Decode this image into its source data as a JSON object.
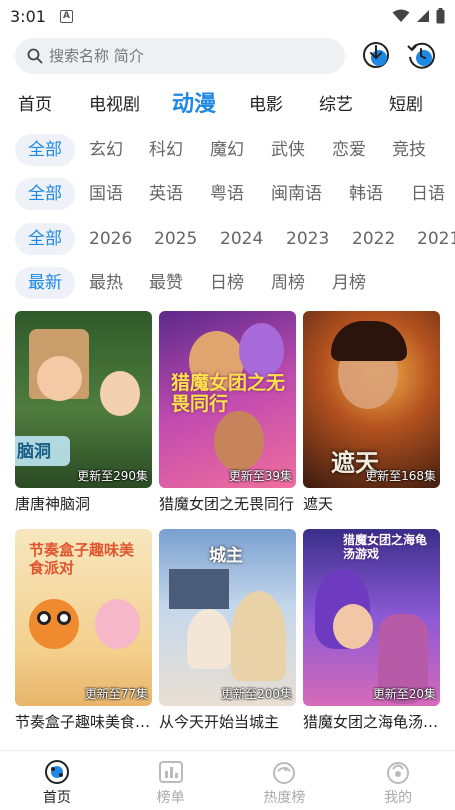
{
  "status": {
    "time": "3:01",
    "notif_icon": "a-badge-icon"
  },
  "search": {
    "placeholder": "搜索名称 简介"
  },
  "top_icons": [
    "download-icon",
    "history-icon"
  ],
  "main_tabs": [
    {
      "label": "首页",
      "active": false
    },
    {
      "label": "电视剧",
      "active": false
    },
    {
      "label": "动漫",
      "active": true
    },
    {
      "label": "电影",
      "active": false
    },
    {
      "label": "综艺",
      "active": false
    },
    {
      "label": "短剧",
      "active": false
    }
  ],
  "filters": {
    "genre": [
      "全部",
      "玄幻",
      "科幻",
      "魔幻",
      "武侠",
      "恋爱",
      "竞技"
    ],
    "language": [
      "全部",
      "国语",
      "英语",
      "粤语",
      "闽南语",
      "韩语",
      "日语"
    ],
    "year": [
      "全部",
      "2026",
      "2025",
      "2024",
      "2023",
      "2022",
      "2021"
    ],
    "sort": [
      "最新",
      "最热",
      "最赞",
      "日榜",
      "周榜",
      "月榜"
    ]
  },
  "cards": [
    {
      "title": "唐唐神脑洞",
      "badge": "更新至290集",
      "thumb_text": "脑洞",
      "bg": "#3f6b35"
    },
    {
      "title": "猎魔女团之无畏同行",
      "badge": "更新至39集",
      "thumb_text": "猎魔女团之无畏同行",
      "bg": "#b048a8"
    },
    {
      "title": "遮天",
      "badge": "更新至168集",
      "thumb_text": "遮天",
      "bg": "#8a3a1e"
    },
    {
      "title": "节奏盒子趣味美食派对",
      "badge": "更新至77集",
      "thumb_text": "节奏盒子趣味美食派对",
      "bg": "#f1d6a0"
    },
    {
      "title": "从今天开始当城主",
      "badge": "更新至200集",
      "thumb_text": "城主",
      "bg": "#6d8fb8"
    },
    {
      "title": "猎魔女团之海龟汤游戏",
      "badge": "更新至20集",
      "thumb_text": "猎魔女团之海龟汤游戏",
      "bg": "#6b4ea8"
    }
  ],
  "bottom_nav": [
    {
      "label": "首页",
      "icon": "home-planet-icon",
      "active": true
    },
    {
      "label": "榜单",
      "icon": "chart-icon",
      "active": false
    },
    {
      "label": "热度榜",
      "icon": "fire-ball-icon",
      "active": false
    },
    {
      "label": "我的",
      "icon": "profile-icon",
      "active": false
    }
  ],
  "colors": {
    "accent": "#1e88e5",
    "chip_bg": "#eef2f8",
    "search_bg": "#eef0f3"
  }
}
